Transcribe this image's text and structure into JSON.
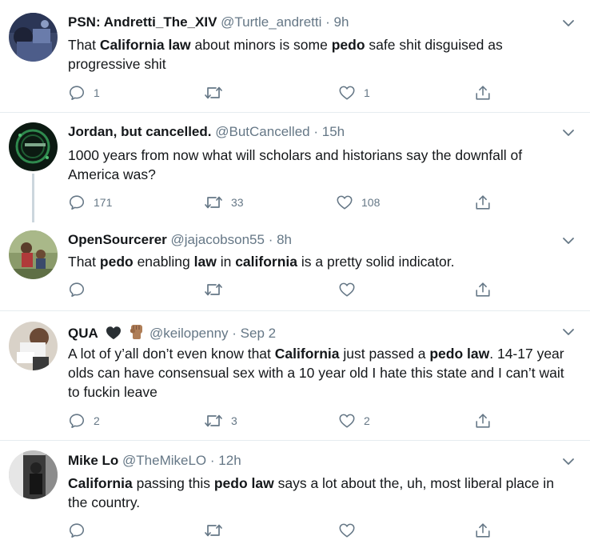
{
  "tweets": [
    {
      "name": "PSN: Andretti_The_XIV",
      "handle": "@Turtle_andretti",
      "time": "9h",
      "body": [
        {
          "text": "That ",
          "bold": false
        },
        {
          "text": "California law",
          "bold": true
        },
        {
          "text": " about minors is some ",
          "bold": false
        },
        {
          "text": "pedo",
          "bold": true
        },
        {
          "text": " safe shit disguised as progressive shit",
          "bold": false
        }
      ],
      "reply_count": "1",
      "retweet_count": "",
      "like_count": "1"
    },
    {
      "name": "Jordan, but cancelled.",
      "handle": "@ButCancelled",
      "time": "15h",
      "body": [
        {
          "text": "1000 years from now what will scholars and historians say the downfall of America was?",
          "bold": false
        }
      ],
      "reply_count": "171",
      "retweet_count": "33",
      "like_count": "108"
    },
    {
      "name": "OpenSourcerer",
      "handle": "@jajacobson55",
      "time": "8h",
      "body": [
        {
          "text": "That ",
          "bold": false
        },
        {
          "text": "pedo",
          "bold": true
        },
        {
          "text": " enabling ",
          "bold": false
        },
        {
          "text": "law",
          "bold": true
        },
        {
          "text": " in ",
          "bold": false
        },
        {
          "text": "california",
          "bold": true
        },
        {
          "text": " is a pretty solid indicator.",
          "bold": false
        }
      ],
      "reply_count": "",
      "retweet_count": "",
      "like_count": ""
    },
    {
      "name": "QUA",
      "handle": "@keilopenny",
      "time": "Sep 2",
      "body": [
        {
          "text": "A lot of y’all don’t even know that ",
          "bold": false
        },
        {
          "text": "California",
          "bold": true
        },
        {
          "text": " just passed a ",
          "bold": false
        },
        {
          "text": "pedo law",
          "bold": true
        },
        {
          "text": ". 14-17 year olds can have consensual sex with a 10 year old I hate this state and I can’t wait to fuckin leave",
          "bold": false
        }
      ],
      "reply_count": "2",
      "retweet_count": "3",
      "like_count": "2"
    },
    {
      "name": "Mike Lo",
      "handle": "@TheMikeLO",
      "time": "12h",
      "body": [
        {
          "text": "California",
          "bold": true
        },
        {
          "text": " passing this ",
          "bold": false
        },
        {
          "text": "pedo law",
          "bold": true
        },
        {
          "text": " says a lot about the, uh, most liberal place in the country.",
          "bold": false
        }
      ],
      "reply_count": "",
      "retweet_count": "",
      "like_count": ""
    }
  ],
  "separator": "·",
  "icons": {
    "reply": "reply-icon",
    "retweet": "retweet-icon",
    "like": "like-icon",
    "share": "share-icon",
    "caret": "chevron-down-icon"
  },
  "colors": {
    "text": "#14171a",
    "muted": "#657786",
    "border": "#e6ecf0",
    "thread_line": "#ccd6dd"
  }
}
